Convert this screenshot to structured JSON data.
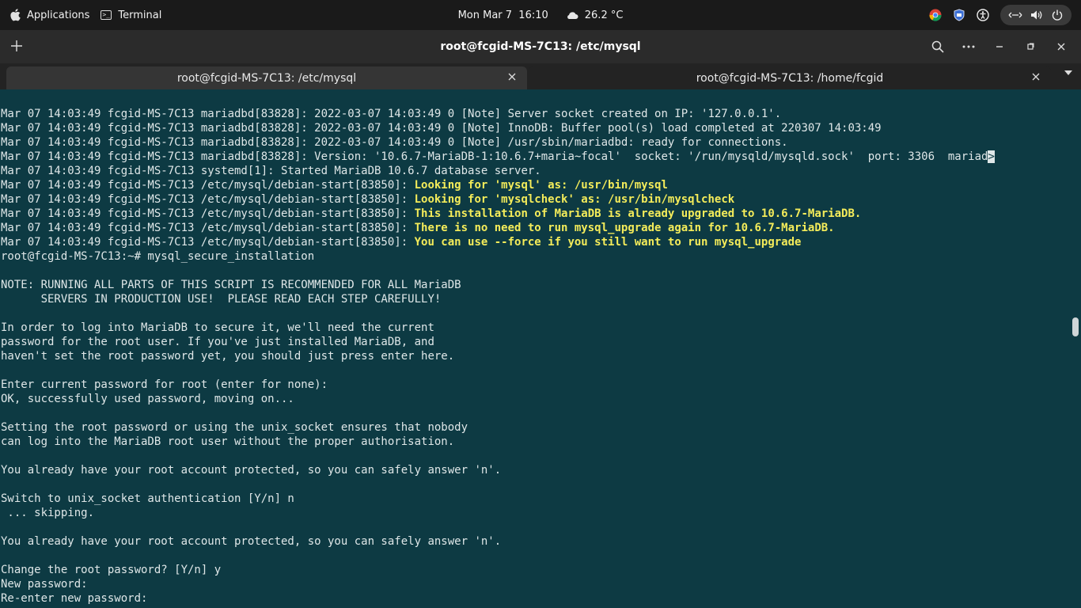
{
  "topbar": {
    "applications_label": "Applications",
    "terminal_label": "Terminal",
    "datetime": "Mon Mar 7  16:10",
    "weather": "26.2 °C"
  },
  "window": {
    "title": "root@fcgid-MS-7C13: /etc/mysql"
  },
  "tabs": [
    {
      "label": "root@fcgid-MS-7C13: /etc/mysql",
      "active": true
    },
    {
      "label": "root@fcgid-MS-7C13: /home/fcgid",
      "active": false
    }
  ],
  "terminal": {
    "lines": [
      {
        "pre": "Mar 07 14:03:49 fcgid-MS-7C13 mariadbd[83828]: 2022-03-07 14:03:49 0 [Note] Server socket created on IP: '127.0.0.1'.",
        "hl": ""
      },
      {
        "pre": "Mar 07 14:03:49 fcgid-MS-7C13 mariadbd[83828]: 2022-03-07 14:03:49 0 [Note] InnoDB: Buffer pool(s) load completed at 220307 14:03:49",
        "hl": ""
      },
      {
        "pre": "Mar 07 14:03:49 fcgid-MS-7C13 mariadbd[83828]: 2022-03-07 14:03:49 0 [Note] /usr/sbin/mariadbd: ready for connections.",
        "hl": ""
      },
      {
        "pre": "Mar 07 14:03:49 fcgid-MS-7C13 mariadbd[83828]: Version: '10.6.7-MariaDB-1:10.6.7+maria~focal'  socket: '/run/mysqld/mysqld.sock'  port: 3306  mariad",
        "hl": "",
        "cursor": ">"
      },
      {
        "pre": "Mar 07 14:03:49 fcgid-MS-7C13 systemd[1]: Started MariaDB 10.6.7 database server.",
        "hl": ""
      },
      {
        "pre": "Mar 07 14:03:49 fcgid-MS-7C13 /etc/mysql/debian-start[83850]: ",
        "hl": "Looking for 'mysql' as: /usr/bin/mysql"
      },
      {
        "pre": "Mar 07 14:03:49 fcgid-MS-7C13 /etc/mysql/debian-start[83850]: ",
        "hl": "Looking for 'mysqlcheck' as: /usr/bin/mysqlcheck"
      },
      {
        "pre": "Mar 07 14:03:49 fcgid-MS-7C13 /etc/mysql/debian-start[83850]: ",
        "hl": "This installation of MariaDB is already upgraded to 10.6.7-MariaDB."
      },
      {
        "pre": "Mar 07 14:03:49 fcgid-MS-7C13 /etc/mysql/debian-start[83850]: ",
        "hl": "There is no need to run mysql_upgrade again for 10.6.7-MariaDB."
      },
      {
        "pre": "Mar 07 14:03:49 fcgid-MS-7C13 /etc/mysql/debian-start[83850]: ",
        "hl": "You can use --force if you still want to run mysql_upgrade"
      },
      {
        "pre": "root@fcgid-MS-7C13:~# mysql_secure_installation",
        "hl": ""
      },
      {
        "pre": "",
        "hl": ""
      },
      {
        "pre": "NOTE: RUNNING ALL PARTS OF THIS SCRIPT IS RECOMMENDED FOR ALL MariaDB",
        "hl": ""
      },
      {
        "pre": "      SERVERS IN PRODUCTION USE!  PLEASE READ EACH STEP CAREFULLY!",
        "hl": ""
      },
      {
        "pre": "",
        "hl": ""
      },
      {
        "pre": "In order to log into MariaDB to secure it, we'll need the current",
        "hl": ""
      },
      {
        "pre": "password for the root user. If you've just installed MariaDB, and",
        "hl": ""
      },
      {
        "pre": "haven't set the root password yet, you should just press enter here.",
        "hl": ""
      },
      {
        "pre": "",
        "hl": ""
      },
      {
        "pre": "Enter current password for root (enter for none):",
        "hl": ""
      },
      {
        "pre": "OK, successfully used password, moving on...",
        "hl": ""
      },
      {
        "pre": "",
        "hl": ""
      },
      {
        "pre": "Setting the root password or using the unix_socket ensures that nobody",
        "hl": ""
      },
      {
        "pre": "can log into the MariaDB root user without the proper authorisation.",
        "hl": ""
      },
      {
        "pre": "",
        "hl": ""
      },
      {
        "pre": "You already have your root account protected, so you can safely answer 'n'.",
        "hl": ""
      },
      {
        "pre": "",
        "hl": ""
      },
      {
        "pre": "Switch to unix_socket authentication [Y/n] n",
        "hl": ""
      },
      {
        "pre": " ... skipping.",
        "hl": ""
      },
      {
        "pre": "",
        "hl": ""
      },
      {
        "pre": "You already have your root account protected, so you can safely answer 'n'.",
        "hl": ""
      },
      {
        "pre": "",
        "hl": ""
      },
      {
        "pre": "Change the root password? [Y/n] y",
        "hl": ""
      },
      {
        "pre": "New password:",
        "hl": ""
      },
      {
        "pre": "Re-enter new password:",
        "hl": ""
      }
    ]
  },
  "colors": {
    "terminal_bg": "#0d3a43",
    "terminal_fg": "#dfe7e8",
    "highlight": "#f4ec5a"
  }
}
